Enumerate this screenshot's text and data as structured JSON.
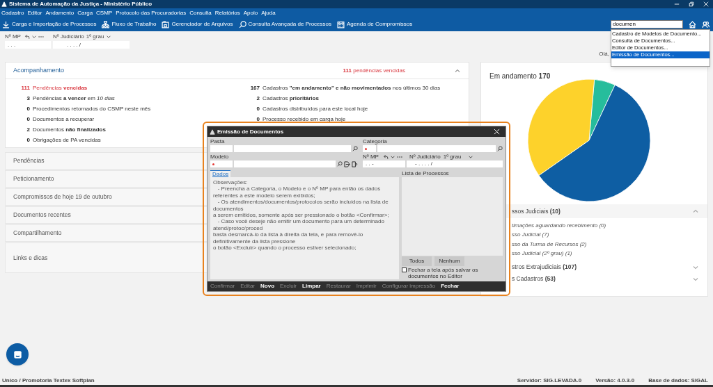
{
  "window": {
    "title": "Sistema de Automação da Justiça - Ministério Público"
  },
  "menu": [
    "Cadastro",
    "Editor",
    "Andamento",
    "Carga",
    "CSMP",
    "Protocolo das Procuradorias",
    "Consulta",
    "Relatórios",
    "Apoio",
    "Ajuda"
  ],
  "toolbar": [
    {
      "label": "Carga e Importação de Processos",
      "kind": "download"
    },
    {
      "label": "Fluxo de Trabalho",
      "kind": "flow"
    },
    {
      "label": "Gerenciador de Arquivos",
      "kind": "files"
    },
    {
      "label": "Consulta Avançada de Processos",
      "kind": "search"
    },
    {
      "label": "Agenda de Compromissos",
      "kind": "calendar"
    }
  ],
  "quick_search": {
    "value": "documen",
    "results": [
      {
        "label": "Cadastro de Modelos de Documento...",
        "selected": false
      },
      {
        "label": "Consulta de Documentos...",
        "selected": false
      },
      {
        "label": "Editor de Documentos...",
        "selected": false
      },
      {
        "label": "Emissão de Documentos...",
        "selected": true
      }
    ]
  },
  "process_fields": {
    "mp_label": "Nº MP",
    "mp_value": ". . .",
    "judicial_label": "Nº Judiciário",
    "instance": "1º grau",
    "judicial_value": ". . . . /"
  },
  "greeting": "Olá,",
  "follow_up": {
    "title": "Acompanhamento",
    "summary": "**111** pendências vencidas",
    "expanded": true,
    "left": [
      {
        "count": "111",
        "text": "Pendências **vencidas**",
        "overdue": true
      },
      {
        "count": "3",
        "text": "Pendências **a vencer** em *10 dias*",
        "overdue": false
      },
      {
        "count": "0",
        "text": "Procedimentos retornados do CSMP neste mês",
        "overdue": false
      },
      {
        "count": "0",
        "text": "Documentos a recuperar",
        "overdue": false
      },
      {
        "count": "2",
        "text": "Documentos **não finalizados**",
        "overdue": false
      },
      {
        "count": "0",
        "text": "Obrigações de PA vencidas",
        "overdue": false
      }
    ],
    "right": [
      {
        "count": "167",
        "text": "Cadastros **\"em andamento\" e não movimentados** nos últimos 30 dias",
        "overdue": false
      },
      {
        "count": "2",
        "text": "Cadastros **prioritários**",
        "overdue": false
      },
      {
        "count": "0",
        "text": "Cadastros distribuídos para este local hoje",
        "overdue": false
      },
      {
        "count": "0",
        "text": "Processo recebido em carga hoje",
        "overdue": false
      }
    ]
  },
  "sections": [
    "Pendências",
    "Peticionamento",
    "Compromissos de hoje 19 de outubro",
    "Documentos recentes",
    "Compartilhamento",
    "Links e dicas"
  ],
  "in_progress": {
    "title": "Em andamento **170**"
  },
  "groups": [
    {
      "title": "ssos Judiciais **(10)**",
      "expanded": true,
      "items": [
        "timações aguardando recebimento (0)",
        "sso Judicial (7)",
        "sso da Turma de Recursos (2)",
        "sso Judicial (2º grau) (1)"
      ]
    },
    {
      "title": "stros Extrajudiciais **(107)**",
      "expanded": false
    },
    {
      "title": "s Cadastros **(53)**",
      "expanded": false
    }
  ],
  "dialog": {
    "title": "Emissão de Documentos",
    "fields": [
      {
        "label": "Pasta",
        "required": false
      },
      {
        "label": "Categoria",
        "required": true
      },
      {
        "label": "Modelo",
        "required": true
      }
    ],
    "mp_label": "Nº MP",
    "mp_value": ". . -",
    "judicial_label": "Nº Judiciário",
    "instance": "1º grau",
    "judicial_value": "- . . . . /",
    "tabs": [
      {
        "label": "Dados",
        "selected": true
      }
    ],
    "notes": [
      "Observações:",
      "   - Preencha a Categoria, o Modelo e o Nº MP para então os dados",
      "referentes a este modelo serem exibidos;",
      "   - Os atendimentos/documentos/protocolos serão incluídos na lista de documentos",
      "a serem emitidos, somente após ser pressionado o botão <Confirmar>;",
      "   - Caso você deseje não emitir um documento para um determinado atend/protoc/proced",
      "basta desmarcá-lo da lista à direita da tela, e para removê-lo definitivamente da lista pressione",
      "o botão <Excluir> quando o processo estiver selecionado;"
    ],
    "list_label": "Lista de Processos",
    "list_buttons": [
      "Todos",
      "Nenhum"
    ],
    "close_option": {
      "label": "Fechar a tela após salvar os documentos no Editor",
      "checked": false
    },
    "actions": [
      {
        "label": "Confirmar",
        "disabled": true
      },
      {
        "label": "Editar",
        "disabled": true
      },
      {
        "label": "Novo",
        "disabled": false
      },
      {
        "label": "Excluir",
        "disabled": true
      },
      {
        "label": "Limpar",
        "disabled": false
      },
      {
        "label": "Restaurar",
        "disabled": true
      },
      {
        "label": "Imprimir",
        "disabled": true
      },
      {
        "label": "Configurar impressão",
        "disabled": true
      },
      {
        "label": "Fechar",
        "disabled": false
      }
    ]
  },
  "status_bar": {
    "left": "Unico / Promotoria Textex Softplan",
    "items": [
      "Servidor: SIG.LEVADA.0",
      "Versão: 4.0.3-0",
      "Base de dados: SIGAL"
    ]
  }
}
